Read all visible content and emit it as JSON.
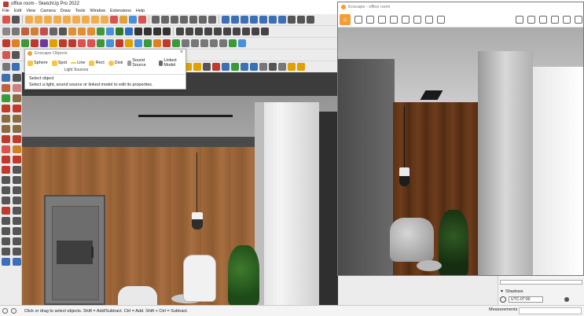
{
  "sketchup": {
    "title": "office room - SketchUp Pro 2022",
    "menu": [
      "File",
      "Edit",
      "View",
      "Camera",
      "Draw",
      "Tools",
      "Window",
      "Extensions",
      "Help"
    ]
  },
  "enscape_objects": {
    "title": "Enscape Objects",
    "close": "×",
    "buttons": [
      "Sphere",
      "Spot",
      "Line",
      "Rect",
      "Disk",
      "Sound Source",
      "Linked Model"
    ],
    "group_label": "Light Sources",
    "status_title": "Select object",
    "status_text": "Select a light, sound source or linked model to edit its properties."
  },
  "enscape": {
    "title": "Enscape - office room"
  },
  "right_panel": {
    "section": "Shadows",
    "timezone": "UTC-07:00"
  },
  "statusbar": {
    "hint": "Click or drag to select objects. Shift = Add/Subtract. Ctrl = Add. Shift + Ctrl = Subtract.",
    "measurements_label": "Measurements"
  },
  "colors": {
    "enscape_orange": "#f29d38",
    "sketchup_red": "#c0392b"
  }
}
